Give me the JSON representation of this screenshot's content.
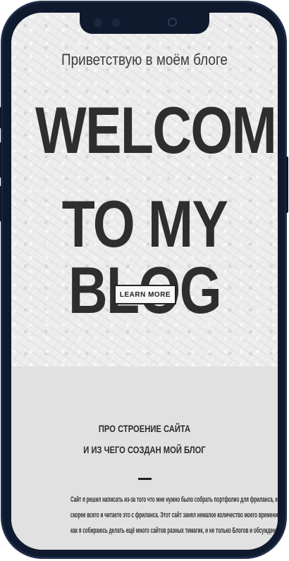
{
  "hero": {
    "greeting": "Приветствую в моём блоге",
    "title_line1": "WELCOME",
    "title_line2": "TO MY BLOG",
    "button_label": "LEARN MORE"
  },
  "about": {
    "heading_line1": "ПРО СТРОЕНИЕ САЙТА",
    "heading_line2": "И ИЗ ЧЕГО СОЗДАН МОЙ БЛОГ",
    "body_lines": [
      "Сайт я решил написать из-за того что мне нужно было собрать портфолио для фриланса, если всё хорошо работает то вы",
      "скорее всего и читаете это с фриланса. Этот сайт занял немалое количество моего времени, но это точно не предел, так",
      "как я собираюсь делать ещё много сайтов разных тимагик, и не только Блогов и обсуждений, а и магазинов и тд."
    ]
  },
  "colors": {
    "hero_bg": "#ececec",
    "section_bg": "#e1e1e1",
    "text": "#2e2e2e",
    "frame": "#0f1a2e"
  }
}
